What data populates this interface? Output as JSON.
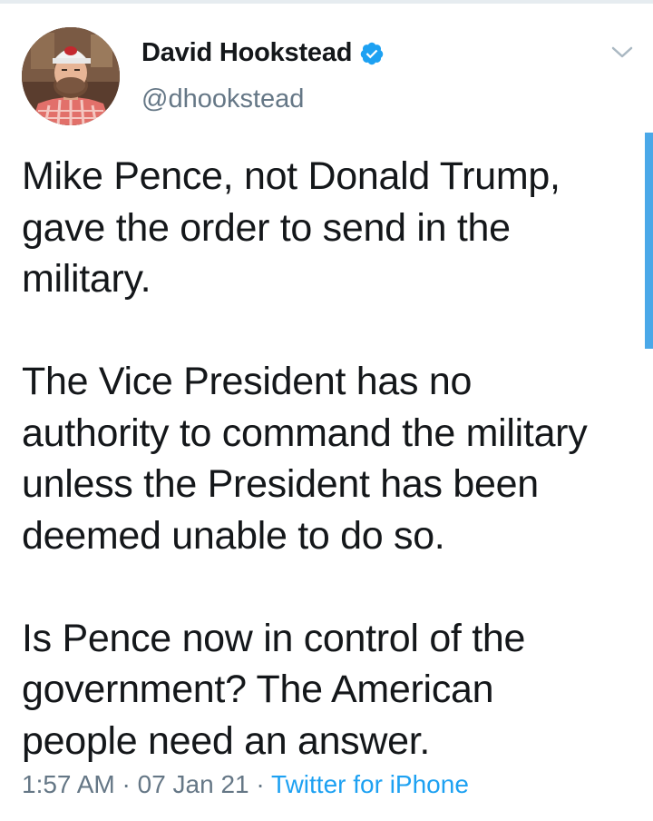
{
  "author": {
    "name": "David Hookstead",
    "handle": "@dhookstead",
    "verified": true
  },
  "tweet": {
    "text": "Mike Pence, not Donald Trump,\ngave the order to send in the\nmilitary.\n\nThe Vice President has no\nauthority to command the military\nunless the President has been\ndeemed unable to do so.\n\nIs Pence now in control of the\ngovernment? The American\npeople need an answer.",
    "time": "1:57 AM",
    "separator": "·",
    "date": "07 Jan 21",
    "source": "Twitter for iPhone"
  },
  "icons": {
    "verified": "verified-badge-icon",
    "more": "chevron-down-icon"
  },
  "colors": {
    "accent": "#1da1f2",
    "text_primary": "#14171a",
    "text_secondary": "#657786"
  }
}
